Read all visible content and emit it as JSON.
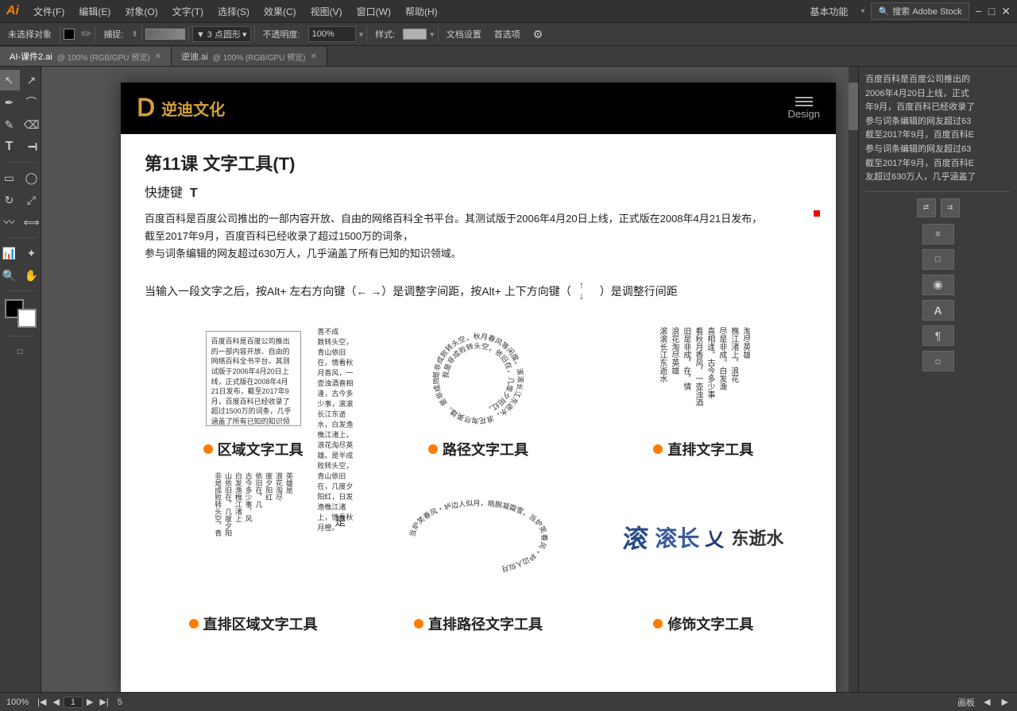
{
  "app": {
    "logo": "Ai",
    "title": "Adobe Illustrator"
  },
  "menu": {
    "items": [
      "文件(F)",
      "编辑(E)",
      "对象(O)",
      "文字(T)",
      "选择(S)",
      "效果(C)",
      "视图(V)",
      "窗口(W)",
      "帮助(H)"
    ]
  },
  "menu_right": {
    "feature": "基本功能",
    "search_placeholder": "搜索 Adobe Stock"
  },
  "toolbar": {
    "no_select": "未选择对象",
    "capture": "捕捉:",
    "point_type": "▼  3 点圆形",
    "opacity_label": "不透明度:",
    "opacity_value": "100%",
    "style_label": "样式:",
    "doc_settings": "文档设置",
    "preferences": "首选项"
  },
  "tabs": [
    {
      "name": "AI-课件2.ai",
      "suffix": "@ 100% (RGB/GPU 预览)",
      "active": true
    },
    {
      "name": "逆迪.ai",
      "suffix": "@ 100% (RGB/GPU 预览)",
      "active": false
    }
  ],
  "artboard": {
    "header": {
      "logo_icon": "Ⅾ",
      "logo_text": "逆迪文化",
      "menu_label": "Design"
    },
    "lesson": {
      "title": "第11课   文字工具(T)",
      "shortcut_label": "快捷键",
      "shortcut_key": "T",
      "description": "百度百科是百度公司推出的一部内容开放、自由的网络百科全书平台。其测试版于2006年4月20日上线，正式版在2008年4月21日发布，截至2017年9月，百度百科已经收录了超过1500万的词条，\n参与词条编辑的网友超过630万人，几乎涵盖了所有已知的知识领域。",
      "alt_tip": "当输入一段文字之后，按Alt+ 左右方向键（← →）是调整字间距，按Alt+ 上下方向键（↑↓）是调整行间距"
    },
    "tools": [
      {
        "id": "area-text",
        "label": "区域文字工具",
        "demo_text_small": "百度百科是百度公司推出的一部内容开放、自由的网络百科全书平台。其测试版于2006年4月20日上线，正式版在2008年4月21日发布，截至2017年9月，百度百科已经收录了超过1500万的词条，几乎涵盖了所有已知的知识领域。"
      },
      {
        "id": "path-text",
        "label": "路径文字工具",
        "demo_text_circle": "是非成败转头空，秋月春风等闲度。滚滚长江东逝水，浪花淘尽英雄。"
      },
      {
        "id": "vertical-text",
        "label": "直排文字工具",
        "demo_text": "旧是非成，在，情看秋月香风，一壶浊酒喜相逢。古今多少事，滚滚长江东逝水，白发渔樵江渚上，浪花淘尽英雄。"
      }
    ],
    "tools2": [
      {
        "id": "vertical-area",
        "label": "直排区域文字工具"
      },
      {
        "id": "vertical-path",
        "label": "直排路径文字工具"
      },
      {
        "id": "decoration",
        "label": "修饰文字工具"
      }
    ]
  },
  "right_panel": {
    "text": "百度百科是百度公司推出的\n2006年4月20日上线，正式\n年9月，百度百科已经收录了\n参与词条编辑的网友超过63\n截至2017年9月，百度百科E\n参与词条编辑的网友超过63\n截至2017年9月，百度百科E\n友超过630万人，几乎涵盖了"
  },
  "status_bar": {
    "zoom": "100%",
    "page_info": "1",
    "total_pages": "5"
  },
  "icons": {
    "arrow_left": "◀",
    "arrow_right": "▶",
    "arrow_up": "↑",
    "arrow_down": "↓",
    "hamburger": "☰",
    "close": "✕",
    "chevron_down": "▾"
  }
}
